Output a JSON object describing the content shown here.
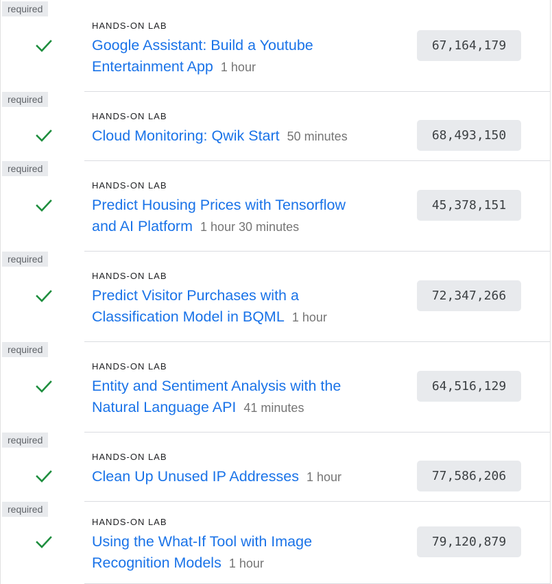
{
  "colors": {
    "link": "#1a73e8",
    "check": "#1e8e3e",
    "badge_bg": "#e8eaed",
    "muted_text": "#757575"
  },
  "labs": [
    {
      "badge": "required",
      "status_icon": "check-icon",
      "type": "HANDS-ON LAB",
      "title": "Google Assistant: Build a Youtube Entertainment App",
      "title_lines": [
        "Google Assistant: Build a Youtube",
        "Entertainment App"
      ],
      "duration": "1 hour",
      "code": "67,164,179"
    },
    {
      "badge": "required",
      "status_icon": "check-icon",
      "type": "HANDS-ON LAB",
      "title": "Cloud Monitoring: Qwik Start",
      "title_lines": [
        "Cloud Monitoring: Qwik Start"
      ],
      "duration": "50 minutes",
      "code": "68,493,150"
    },
    {
      "badge": "required",
      "status_icon": "check-icon",
      "type": "HANDS-ON LAB",
      "title": "Predict Housing Prices with Tensorflow and AI Platform",
      "title_lines": [
        "Predict Housing Prices with Tensorflow",
        "and AI Platform"
      ],
      "duration": "1 hour 30 minutes",
      "code": "45,378,151"
    },
    {
      "badge": "required",
      "status_icon": "check-icon",
      "type": "HANDS-ON LAB",
      "title": "Predict Visitor Purchases with a Classification Model in BQML",
      "title_lines": [
        "Predict Visitor Purchases with a",
        "Classification Model in BQML"
      ],
      "duration": "1 hour",
      "code": "72,347,266"
    },
    {
      "badge": "required",
      "status_icon": "check-icon",
      "type": "HANDS-ON LAB",
      "title": "Entity and Sentiment Analysis with the Natural Language API",
      "title_lines": [
        "Entity and Sentiment Analysis with the",
        "Natural Language API"
      ],
      "duration": "41 minutes",
      "code": "64,516,129"
    },
    {
      "badge": "required",
      "status_icon": "check-icon",
      "type": "HANDS-ON LAB",
      "title": "Clean Up Unused IP Addresses",
      "title_lines": [
        "Clean Up Unused IP Addresses"
      ],
      "duration": "1 hour",
      "code": "77,586,206"
    },
    {
      "badge": "required",
      "status_icon": "check-icon",
      "type": "HANDS-ON LAB",
      "title": "Using the What-If Tool with Image Recognition Models",
      "title_lines": [
        "Using the What-If Tool with Image",
        "Recognition Models"
      ],
      "duration": "1 hour",
      "code": "79,120,879"
    }
  ]
}
